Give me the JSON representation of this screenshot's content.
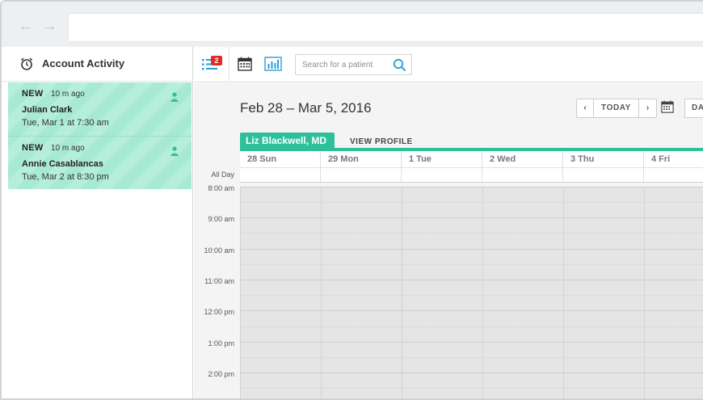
{
  "sidebar": {
    "title": "Account Activity",
    "items": [
      {
        "status": "NEW",
        "time_ago": "10 m ago",
        "name": "Julian Clark",
        "appointment": "Tue, Mar 1 at 7:30 am"
      },
      {
        "status": "NEW",
        "time_ago": "10 m ago",
        "name": "Annie Casablancas",
        "appointment": "Tue, Mar 2 at 8:30 pm"
      }
    ]
  },
  "toolbar": {
    "notification_count": "2",
    "search_placeholder": "Search for a patient"
  },
  "calendar": {
    "date_range": "Feb 28 – Mar 5, 2016",
    "buttons": {
      "prev": "‹",
      "today": "TODAY",
      "next": "›",
      "day": "DAY"
    },
    "provider": "Liz Blackwell, MD",
    "view_profile": "VIEW PROFILE",
    "all_day_label": "All Day",
    "days": [
      "28 Sun",
      "29 Mon",
      "1 Tue",
      "2 Wed",
      "3 Thu",
      "4 Fri"
    ],
    "times": [
      "8:00 am",
      "9:00 am",
      "10:00 am",
      "11:00 am",
      "12:00 pm",
      "1:00 pm",
      "2:00 pm"
    ]
  },
  "colors": {
    "accent": "#2fc09a",
    "badge": "#e02b2b",
    "activity_bg": "#a8e9d3"
  }
}
